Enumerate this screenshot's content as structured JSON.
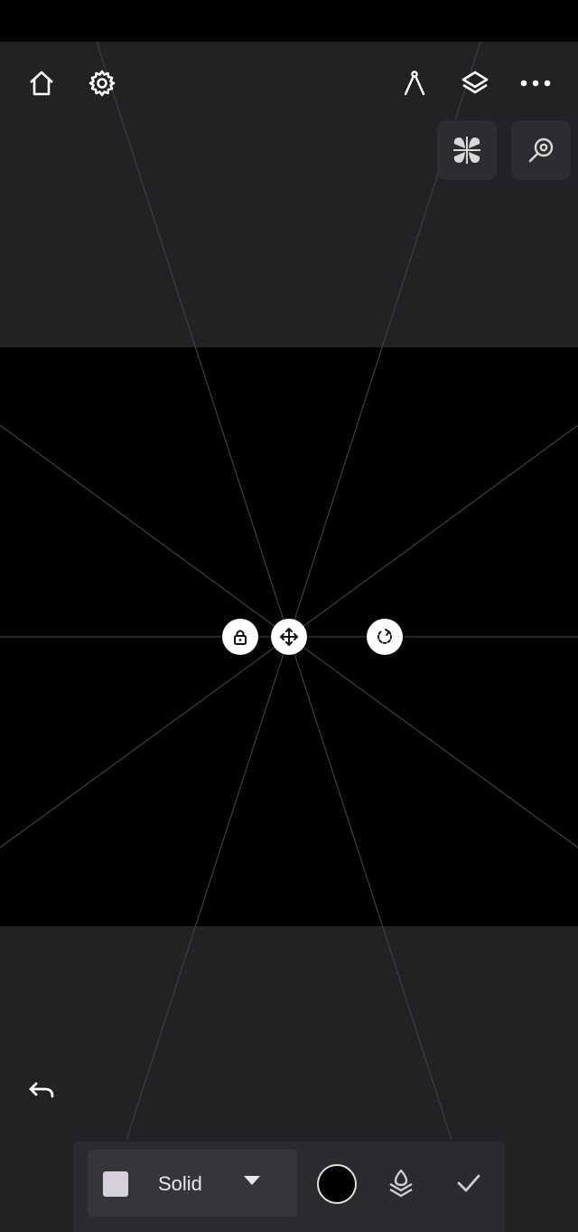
{
  "toolbar": {
    "home_icon": "home-icon",
    "settings_icon": "gear-icon",
    "compass_icon": "compass-icon",
    "layers_icon": "layers-icon",
    "more_icon": "more-horizontal-icon"
  },
  "quick_tools": {
    "symmetry_icon": "symmetry-icon",
    "zoom_icon": "zoom-icon"
  },
  "canvas_handles": {
    "lock_icon": "lock-icon",
    "move_icon": "move-arrows-icon",
    "rotate_icon": "rotate-icon"
  },
  "undo_icon": "undo-icon",
  "bottom_panel": {
    "style_label": "Solid",
    "swatch_color": "#d6cfdc",
    "selected_color": "#000000",
    "layer_icon": "layer-opacity-icon",
    "confirm_icon": "checkmark-icon"
  }
}
